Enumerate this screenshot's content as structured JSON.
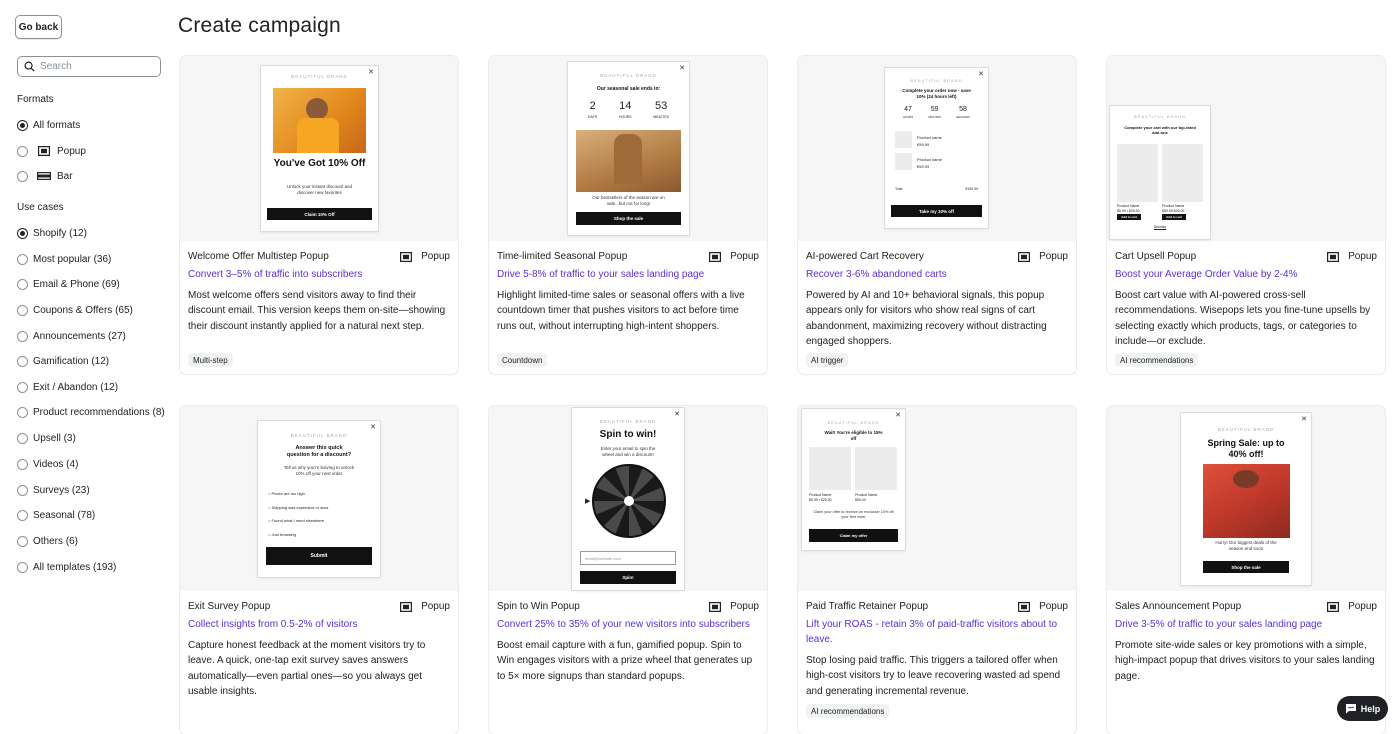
{
  "header": {
    "back_label": "Go back",
    "title": "Create campaign"
  },
  "sidebar": {
    "search_placeholder": "Search",
    "formats_label": "Formats",
    "formats": [
      {
        "label": "All formats",
        "checked": true,
        "icon": ""
      },
      {
        "label": "Popup",
        "checked": false,
        "icon": "popup-icon"
      },
      {
        "label": "Bar",
        "checked": false,
        "icon": "bar-icon"
      }
    ],
    "use_cases_label": "Use cases",
    "use_cases": [
      {
        "label": "Shopify (12)",
        "checked": true
      },
      {
        "label": "Most popular (36)",
        "checked": false
      },
      {
        "label": "Email & Phone (69)",
        "checked": false
      },
      {
        "label": "Coupons & Offers (65)",
        "checked": false
      },
      {
        "label": "Announcements (27)",
        "checked": false
      },
      {
        "label": "Gamification (12)",
        "checked": false
      },
      {
        "label": "Exit / Abandon (12)",
        "checked": false
      },
      {
        "label": "Product recommendations (8)",
        "checked": false
      },
      {
        "label": "Upsell (3)",
        "checked": false
      },
      {
        "label": "Videos (4)",
        "checked": false
      },
      {
        "label": "Surveys (23)",
        "checked": false
      },
      {
        "label": "Seasonal (78)",
        "checked": false
      },
      {
        "label": "Others (6)",
        "checked": false
      },
      {
        "label": "All templates (193)",
        "checked": false
      }
    ]
  },
  "cards": [
    {
      "title": "Welcome Offer Multistep Popup",
      "format": "Popup",
      "subtitle": "Convert 3–5% of traffic into subscribers",
      "description": "Most welcome offers send visitors away to find their discount email. This version keeps them on-site—showing their discount instantly applied for a natural next step.",
      "tag": "Multi-step",
      "preview": {
        "brand": "BEAUTIFUL BRAND",
        "headline": "You've Got 10% Off",
        "body": "Unlock your instant discount and discover new favorites",
        "button": "Claim 10% Off"
      }
    },
    {
      "title": "Time-limited Seasonal Popup",
      "format": "Popup",
      "subtitle": "Drive 5-8% of traffic to your sales landing page",
      "description": "Highlight limited-time sales or seasonal offers with a live countdown timer that pushes visitors to act before time runs out, without interrupting high-intent shoppers.",
      "tag": "Countdown",
      "preview": {
        "brand": "BEAUTIFUL BRAND",
        "headline": "Our seasonal sale ends in:",
        "days": "2",
        "hours": "14",
        "minutes": "53",
        "days_label": "DAYS",
        "hours_label": "HOURS",
        "minutes_label": "MINUTES",
        "body": "Our bestsellers of the season are on sale...but not for long!",
        "button": "Shop the sale"
      }
    },
    {
      "title": "AI-powered Cart Recovery",
      "format": "Popup",
      "subtitle": "Recover 3-6% abandoned carts",
      "description": "Powered by AI and 10+ behavioral signals, this popup appears only for visitors who show real signs of cart abandonment, maximizing recovery without distracting engaged shoppers.",
      "tag": "AI trigger",
      "preview": {
        "brand": "BEAUTIFUL BRAND",
        "headline": "Complete your order now - save 10% (24 hours left)",
        "hours": "47",
        "minutes": "59",
        "seconds": "58",
        "hours_label": "HOURS",
        "minutes_label": "MINUTES",
        "seconds_label": "SECONDS",
        "product1": "Product name",
        "price1": "€59.99",
        "product2": "Product name",
        "price2": "€59.99",
        "total_label": "Total",
        "total": "€159.99",
        "button": "Take my 10% off"
      }
    },
    {
      "title": "Cart Upsell Popup",
      "format": "Popup",
      "subtitle": "Boost your Average Order Value by 2-4%",
      "description": "Boost cart value with AI-powered cross-sell recommendations. Wisepops lets you fine-tune upsells by selecting exactly which products, tags, or categories to include—or exclude.",
      "tag": "AI recommendations",
      "preview": {
        "brand": "BEAUTIFUL BRAND",
        "headline": "Complete your cart with our top-rated add-ons",
        "product1": "Product Name",
        "price1": "$5.99 • $25.00",
        "product2": "Product Name",
        "price2": "$59.99 $25.00",
        "add_label": "Add to cart",
        "dismiss": "Dismiss"
      }
    },
    {
      "title": "Exit Survey Popup",
      "format": "Popup",
      "subtitle": "Collect insights from 0.5-2% of visitors",
      "description": "Capture honest feedback at the moment visitors try to leave. A quick, one-tap exit survey saves answers automatically—even partial ones—so you always get usable insights.",
      "tag": "",
      "preview": {
        "brand": "BEAUTIFUL BRAND",
        "headline": "Answer this quick question for a discount?",
        "body": "Tell us why you're leaving to unlock 10% off your next order",
        "options": [
          "Prices are too high",
          "Shipping was expensive or slow",
          "Found what I need elsewhere",
          "Just browsing"
        ],
        "button": "Submit"
      }
    },
    {
      "title": "Spin to Win Popup",
      "format": "Popup",
      "subtitle": "Convert 25% to 35% of your new visitors into subscribers",
      "description": "Boost email capture with a fun, gamified popup. Spin to Win engages visitors with a prize wheel that generates up to 5× more signups than standard popups.",
      "tag": "",
      "preview": {
        "brand": "BEAUTIFUL BRAND",
        "headline": "Spin to win!",
        "body": "Enter your email to spin the wheel and win a discount!",
        "email_placeholder": "email@website.com",
        "button": "Spin!"
      }
    },
    {
      "title": "Paid Traffic Retainer Popup",
      "format": "Popup",
      "subtitle": "Lift your ROAS - retain 3% of paid-traffic visitors about to leave.",
      "description": "Stop losing paid traffic. This triggers a tailored offer when high-cost visitors try to leave recovering wasted ad spend and generating incremental revenue.",
      "tag": "AI recommendations",
      "preview": {
        "brand": "BEAUTIFUL BRAND",
        "headline": "Wait! You're eligible to 15% off",
        "product1": "Product Name",
        "price1": "$5.99 • $25.00",
        "product2": "Product Name",
        "price2": "$50.00",
        "body": "Claim your offer to receive an exclusive 15% off your first order",
        "button": "Claim my offer"
      }
    },
    {
      "title": "Sales Announcement Popup",
      "format": "Popup",
      "subtitle": "Drive 3-5% of traffic to your sales landing page",
      "description": "Promote site-wide sales or key promotions with a simple, high-impact popup that drives visitors to your sales landing page.",
      "tag": "",
      "preview": {
        "brand": "BEAUTIFUL BRAND",
        "headline": "Spring Sale: up to 40% off!",
        "body": "Hurry! Our biggest deals of the season end soon",
        "button": "Shop the sale"
      }
    }
  ],
  "help": {
    "label": "Help"
  },
  "colors": {
    "accent": "#5c2fd6",
    "text": "#202223",
    "chip_bg": "#f1f2f3",
    "orange": "#e69a2e",
    "brown": "#b07a44",
    "red": "#c0392b"
  }
}
